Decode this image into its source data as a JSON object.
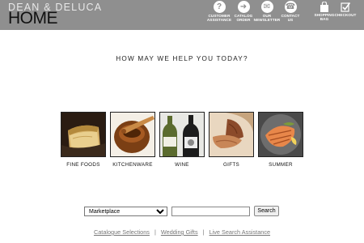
{
  "header": {
    "brand": "DEAN & DELUCA",
    "page": "HOME",
    "nav": [
      {
        "label_1": "CUSTOMER",
        "label_2": "ASSISTANCE",
        "icon": "question-icon"
      },
      {
        "label_1": "CATALOG",
        "label_2": "ORDER",
        "icon": "arrow-right-icon"
      },
      {
        "label_1": "OUR",
        "label_2": "NEWSLETTER",
        "icon": "envelope-icon"
      },
      {
        "label_1": "CONTACT",
        "label_2": "US",
        "icon": "phone-icon"
      },
      {
        "label_1": "SHOPPING",
        "label_2": "BAG",
        "icon": "shopping-bag-icon"
      },
      {
        "label_1": "CHECKOUT",
        "label_2": "",
        "icon": "checkmark-icon"
      }
    ]
  },
  "main": {
    "headline": "HOW MAY WE HELP YOU TODAY?",
    "categories": [
      {
        "label": "FINE FOODS"
      },
      {
        "label": "KITCHENWARE"
      },
      {
        "label": "WINE"
      },
      {
        "label": "GIFTS"
      },
      {
        "label": "SUMMER"
      }
    ]
  },
  "search": {
    "select_value": "Marketplace",
    "query_value": "",
    "button_label": "Search"
  },
  "footer_links": [
    {
      "label": "Catalogue Selections"
    },
    {
      "label": "Wedding Gifts"
    },
    {
      "label": "Live Search Assistance"
    }
  ],
  "colors": {
    "header_bg": "#8f8f8f",
    "header_text": "#ffffff",
    "link": "#777777"
  }
}
